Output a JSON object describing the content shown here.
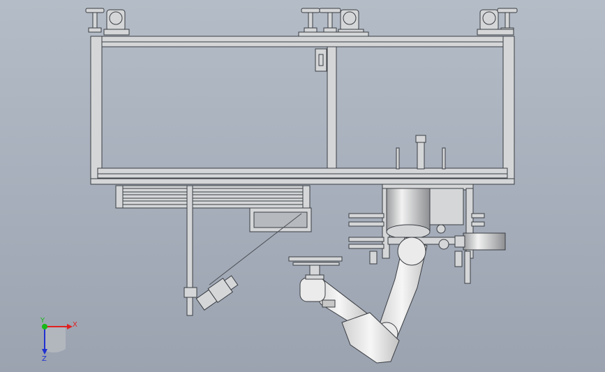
{
  "scene": {
    "background_top": "#b4bcc7",
    "background_bottom": "#9ba3b0",
    "part_fill": "#d4d6d8",
    "part_stroke": "#3a3d42",
    "robot_fill": "#ebebeb"
  },
  "triad": {
    "x_label": "X",
    "y_label": "Y",
    "z_label": "Z",
    "x_color": "#e02020",
    "y_color": "#18b818",
    "z_color": "#2030d0"
  }
}
